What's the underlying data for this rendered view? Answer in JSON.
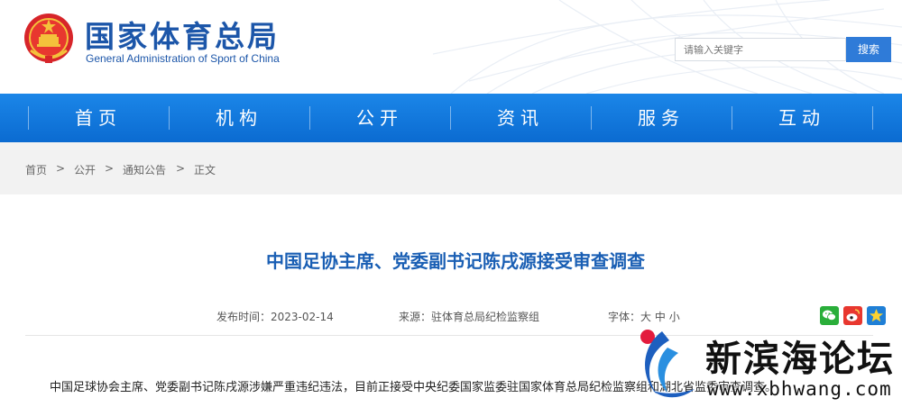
{
  "header": {
    "title_cn": "国家体育总局",
    "title_en": "General Administration of Sport of China",
    "search_placeholder": "请输入关键字",
    "search_button": "搜索"
  },
  "nav": {
    "items": [
      {
        "label": "首页"
      },
      {
        "label": "机构"
      },
      {
        "label": "公开"
      },
      {
        "label": "资讯"
      },
      {
        "label": "服务"
      },
      {
        "label": "互动"
      }
    ]
  },
  "breadcrumb": {
    "items": [
      "首页",
      "公开",
      "通知公告",
      "正文"
    ],
    "separator": ">"
  },
  "article": {
    "title": "中国足协主席、党委副书记陈戌源接受审查调查",
    "publish_time_label": "发布时间：",
    "publish_time": "2023-02-14",
    "source_label": "来源：",
    "source": "驻体育总局纪检监察组",
    "font_label": "字体：",
    "font_sizes": [
      "大",
      "中",
      "小"
    ],
    "body_first_line": "中国足球协会主席、党委副书记陈戌源涉嫌严重违纪违法，目前正接受中央纪委国家监委驻国家体育总局纪检监察组和湖北省监委审查调查。"
  },
  "share": {
    "icons": [
      "wechat-icon",
      "weibo-icon",
      "favorite-icon"
    ]
  },
  "watermark": {
    "name_cn": "新滨海论坛",
    "url": "www.xbhwang.com"
  },
  "colors": {
    "brand_blue": "#1c56a9",
    "nav_blue": "#0b6bd1",
    "title_blue": "#1a5fb4",
    "search_button": "#2f7bd8"
  }
}
